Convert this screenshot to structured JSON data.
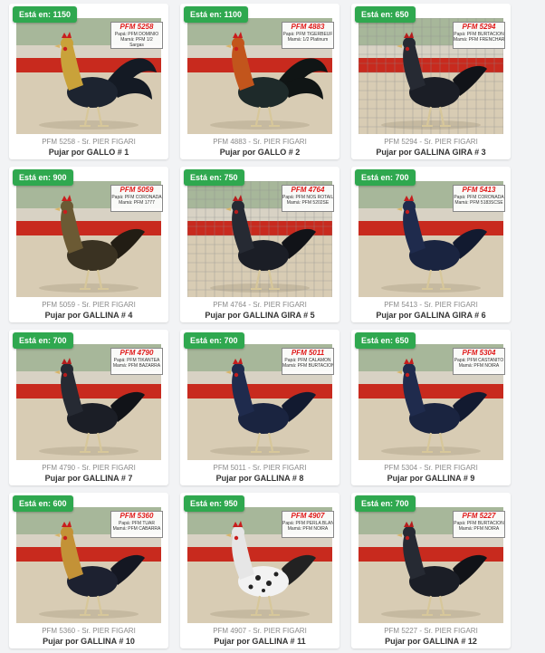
{
  "owner": "Sr. PIER FIGARI",
  "bid_prefix": "Está en:",
  "colors": {
    "badge": "#2fa84f",
    "tag_code": "#e01919"
  },
  "lots": [
    {
      "code": "PFM 5258",
      "price": "1150",
      "line1": "Papá: PFM DOMINIO",
      "line2": "Mamá: PFM 1/2",
      "line3": "Sargas",
      "bird": "rooster-gold",
      "bg": "dirt"
    },
    {
      "code": "PFM 4883",
      "price": "1100",
      "line1": "Papá: PFM TIGERBEUF",
      "line2": "Mamá: 1/2 Platinum",
      "line3": "",
      "bird": "rooster-red",
      "bg": "dirt"
    },
    {
      "code": "PFM 5294",
      "price": "650",
      "line1": "Papá: PFM BURTACIÓN",
      "line2": "Mamá: PFM FRENCHARTS",
      "line3": "",
      "bird": "hen-black",
      "bg": "cage"
    },
    {
      "code": "PFM 5059",
      "price": "900",
      "line1": "Papá: PFM CORONADA",
      "line2": "Mamá: PFM 1777",
      "line3": "",
      "bird": "hen-brown",
      "bg": "dirt"
    },
    {
      "code": "PFM 4764",
      "price": "750",
      "line1": "Papá: PFM NOS ROTAIL",
      "line2": "Mamá: PFM 5202SE",
      "line3": "",
      "bird": "hen-black",
      "bg": "cage"
    },
    {
      "code": "PFM 5413",
      "price": "700",
      "line1": "Papá: PFM CORONADA",
      "line2": "Mamá: PFM 5183SCSE",
      "line3": "",
      "bird": "hen-blue",
      "bg": "dirt"
    },
    {
      "code": "PFM 4790",
      "price": "700",
      "line1": "Papá: PFM TIKANTEA",
      "line2": "Mamá: PFM BAZARRA",
      "line3": "",
      "bird": "hen-black",
      "bg": "dirt"
    },
    {
      "code": "PFM 5011",
      "price": "700",
      "line1": "Papá: PFM CALAMÓN",
      "line2": "Mamá: PFM BURTACIÓN",
      "line3": "",
      "bird": "hen-blue",
      "bg": "dirt"
    },
    {
      "code": "PFM 5304",
      "price": "650",
      "line1": "Papá: PFM CASTAÑITO",
      "line2": "Mamá: PFM NOIRA",
      "line3": "",
      "bird": "hen-blue",
      "bg": "dirt"
    },
    {
      "code": "PFM 5360",
      "price": "600",
      "line1": "Papá: PFM TUAR",
      "line2": "Mamá: PFM CABARRA",
      "line3": "",
      "bird": "hen-gold",
      "bg": "dirt"
    },
    {
      "code": "PFM 4907",
      "price": "950",
      "line1": "Papá: PFM PERLA BLANCA",
      "line2": "Mamá: PFM NOIRA",
      "line3": "",
      "bird": "hen-white",
      "bg": "dirt"
    },
    {
      "code": "PFM 5227",
      "price": "700",
      "line1": "Papá: PFM BURTACIÓN",
      "line2": "Mamá: PFM NOIRA",
      "line3": "",
      "bird": "hen-black",
      "bg": "dirt"
    }
  ],
  "titles": [
    "Pujar por GALLO # 1",
    "Pujar por GALLO # 2",
    "Pujar por GALLINA GIRA # 3",
    "Pujar por GALLINA # 4",
    "Pujar por GALLINA GIRA # 5",
    "Pujar por GALLINA GIRA # 6",
    "Pujar por GALLINA # 7",
    "Pujar por GALLINA # 8",
    "Pujar por GALLINA # 9",
    "Pujar por GALLINA # 10",
    "Pujar por GALLINA # 11",
    "Pujar por GALLINA # 12"
  ]
}
